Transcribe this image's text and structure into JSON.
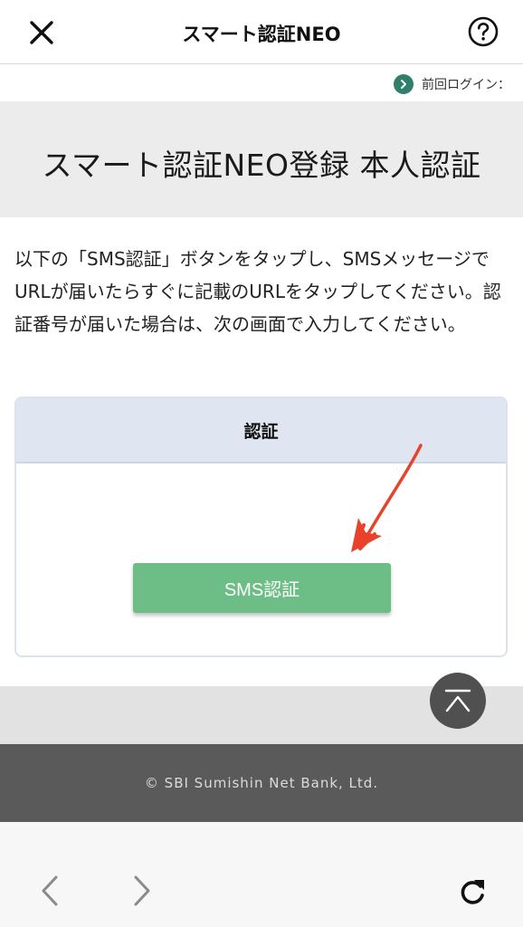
{
  "header": {
    "title": "スマート認証NEO",
    "close_icon": "close-icon",
    "help_icon": "question-circle-icon"
  },
  "last_login": {
    "label": "前回ログイン：",
    "icon": "chevron-right-circle-icon"
  },
  "page_title": "スマート認証NEO登録 本人認証",
  "instruction": "以下の「SMS認証」ボタンをタップし、SMSメッセージでURLが届いたらすぐに記載のURLをタップしてください。認証番号が届いた場合は、次の画面で入力してください。",
  "auth_card": {
    "heading": "認証",
    "sms_button_label": "SMS認証"
  },
  "scroll_top_icon": "chevron-up-icon",
  "footer": {
    "copyright": "© SBI Sumishin Net Bank, Ltd."
  },
  "browser_bar": {
    "back_icon": "chevron-left-icon",
    "forward_icon": "chevron-right-icon",
    "reload_icon": "reload-icon"
  },
  "colors": {
    "sms_button": "#6dbd87",
    "card_header": "#dfe6f2",
    "annotation_arrow": "#e8432a",
    "footer": "#5a5a5a"
  }
}
